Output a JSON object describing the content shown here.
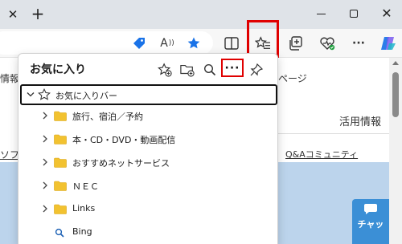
{
  "browser": {
    "tab_close_glyph": "✕",
    "new_tab_glyph": "+",
    "window_close_glyph": "✕"
  },
  "toolbar": {
    "icons": [
      "shopping-tag-icon",
      "read-aloud-icon",
      "favorite-star-icon",
      "split-screen-icon",
      "favorites-icon",
      "collections-icon",
      "browser-essentials-icon",
      "more-icon",
      "copilot-icon"
    ],
    "read_aloud_glyph": "A",
    "more_glyph": "···",
    "accent": "#1a73e8"
  },
  "page": {
    "nav_left": "情報",
    "nav_right": "ページ",
    "nav_item": "活用情報",
    "link_left": "ソフ",
    "link_qa": "Q&Aコミュニティ",
    "chat_label": "チャッ",
    "hero_color": "#bcd4ec",
    "chat_color": "#3b8fd6"
  },
  "favorites": {
    "title": "お気に入り",
    "more_label": "···",
    "highlight_color": "#e00000",
    "favorites_bar": "お気に入りバー",
    "items": [
      {
        "label": "旅行、宿泊／予約",
        "type": "folder"
      },
      {
        "label": "本・CD・DVD・動画配信",
        "type": "folder"
      },
      {
        "label": "おすすめネットサービス",
        "type": "folder"
      },
      {
        "label": "ＮＥＣ",
        "type": "folder"
      },
      {
        "label": "Links",
        "type": "folder"
      },
      {
        "label": "Bing",
        "type": "link"
      }
    ]
  }
}
